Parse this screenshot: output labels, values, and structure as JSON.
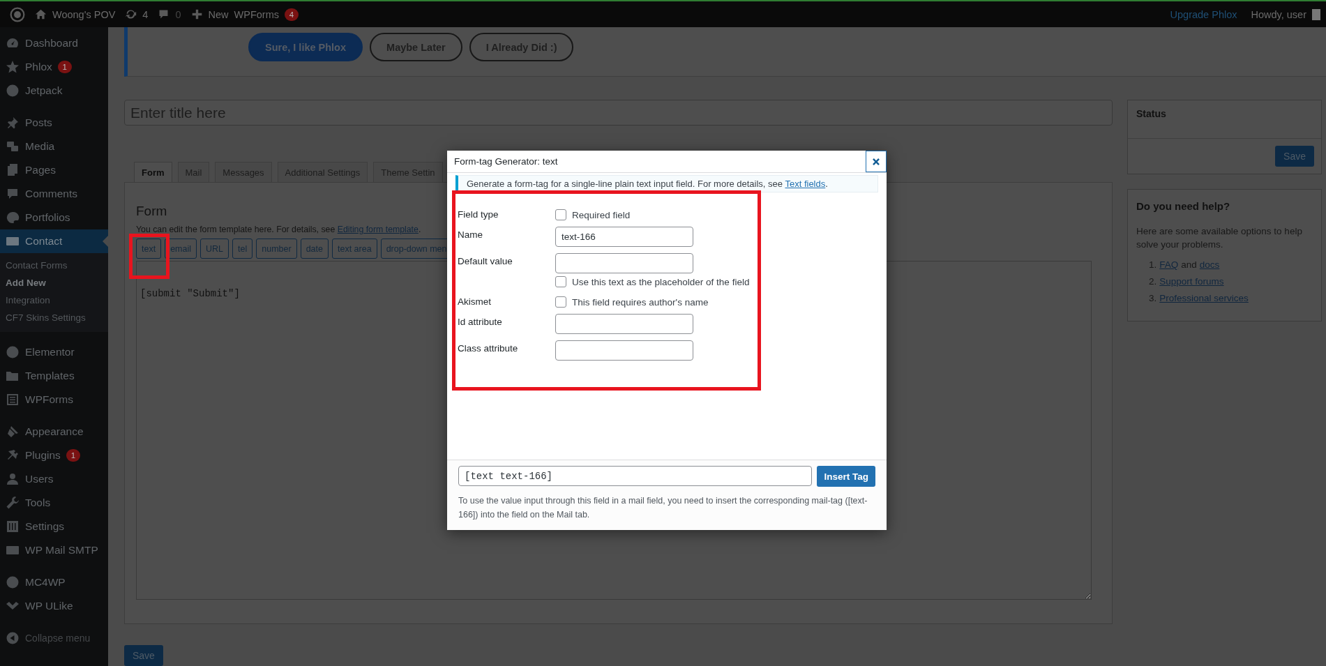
{
  "admin_bar": {
    "site": "Woong's POV",
    "updates": "4",
    "comments": "0",
    "new": "New",
    "wpforms": "WPForms",
    "wpforms_count": "4",
    "upgrade": "Upgrade Phlox",
    "howdy": "Howdy, user"
  },
  "sidebar": {
    "groups": [
      {
        "items": [
          {
            "label": "Dashboard",
            "selected": false
          },
          {
            "label": "Phlox",
            "selected": false,
            "badge": "1"
          },
          {
            "label": "Jetpack",
            "selected": false
          }
        ]
      },
      {
        "items": [
          {
            "label": "Posts",
            "selected": false
          },
          {
            "label": "Media",
            "selected": false
          },
          {
            "label": "Pages",
            "selected": false
          },
          {
            "label": "Comments",
            "selected": false
          },
          {
            "label": "Portfolios",
            "selected": false
          },
          {
            "label": "Contact",
            "selected": true,
            "children": [
              {
                "label": "Contact Forms",
                "selected": false
              },
              {
                "label": "Add New",
                "selected": true
              },
              {
                "label": "Integration",
                "selected": false
              },
              {
                "label": "CF7 Skins Settings",
                "selected": false
              }
            ]
          }
        ]
      },
      {
        "items": [
          {
            "label": "Elementor",
            "selected": false
          },
          {
            "label": "Templates",
            "selected": false
          },
          {
            "label": "WPForms",
            "selected": false
          }
        ]
      },
      {
        "items": [
          {
            "label": "Appearance",
            "selected": false
          },
          {
            "label": "Plugins",
            "selected": false,
            "badge": "1"
          },
          {
            "label": "Users",
            "selected": false
          },
          {
            "label": "Tools",
            "selected": false
          },
          {
            "label": "Settings",
            "selected": false
          },
          {
            "label": "WP Mail SMTP",
            "selected": false
          }
        ]
      },
      {
        "items": [
          {
            "label": "MC4WP",
            "selected": false
          },
          {
            "label": "WP ULike",
            "selected": false
          }
        ]
      }
    ],
    "collapse": "Collapse menu"
  },
  "notice": {
    "buttons": [
      {
        "label": "Sure, I like Phlox",
        "kind": "primary"
      },
      {
        "label": "Maybe Later",
        "kind": "outline"
      },
      {
        "label": "I Already Did :)",
        "kind": "outline"
      }
    ]
  },
  "title_field": {
    "placeholder": "Enter title here"
  },
  "tabs": [
    {
      "label": "Form",
      "selected": true
    },
    {
      "label": "Mail",
      "selected": false
    },
    {
      "label": "Messages",
      "selected": false
    },
    {
      "label": "Additional Settings",
      "selected": false
    },
    {
      "label": "Theme Settin",
      "selected": false
    }
  ],
  "form_panel": {
    "heading": "Form",
    "description": "You can edit the form template here. For details, see ",
    "link": "Editing form template",
    "description_end": ".",
    "tag_buttons": [
      "text",
      "email",
      "URL",
      "tel",
      "number",
      "date",
      "text area",
      "drop-down men"
    ],
    "template": "[submit \"Submit\"]",
    "save": "Save"
  },
  "status_box": {
    "title": "Status",
    "save": "Save"
  },
  "help_box": {
    "title": "Do you need help?",
    "text": "Here are some available options to help solve your problems.",
    "items": [
      {
        "number": "1.",
        "parts": [
          {
            "kind": "link",
            "text": "FAQ"
          },
          {
            "kind": "text",
            "text": "and"
          },
          {
            "kind": "link",
            "text": "docs"
          }
        ]
      },
      {
        "number": "2.",
        "parts": [
          {
            "kind": "link",
            "text": "Support forums"
          }
        ]
      },
      {
        "number": "3.",
        "parts": [
          {
            "kind": "link",
            "text": "Professional services"
          }
        ]
      }
    ]
  },
  "dialog": {
    "title": "Form-tag Generator: text",
    "notice": "Generate a form-tag for a single-line plain text input field. For more details, see ",
    "notice_link": "Text fields",
    "notice_end": ".",
    "rows": [
      {
        "kind": "checks",
        "label": "Field type",
        "options": [
          {
            "label": "Required field",
            "checked": false
          }
        ]
      },
      {
        "kind": "input",
        "label": "Name",
        "value": "text-166"
      },
      {
        "kind": "input",
        "label": "Default value",
        "options": [
          {
            "label": "Use this text as the placeholder of the field",
            "checked": false
          }
        ]
      },
      {
        "kind": "checks",
        "label": "Akismet",
        "options": [
          {
            "label": "This field requires author's name",
            "checked": false
          }
        ]
      },
      {
        "kind": "input",
        "label": "Id attribute"
      },
      {
        "kind": "input",
        "label": "Class attribute"
      }
    ],
    "tag": "[text text-166]",
    "insert": "Insert Tag",
    "mail_note": "To use the value input through this field in a mail field, you need to insert the corresponding mail-tag ([text-166]) into the field on the Mail tab."
  }
}
